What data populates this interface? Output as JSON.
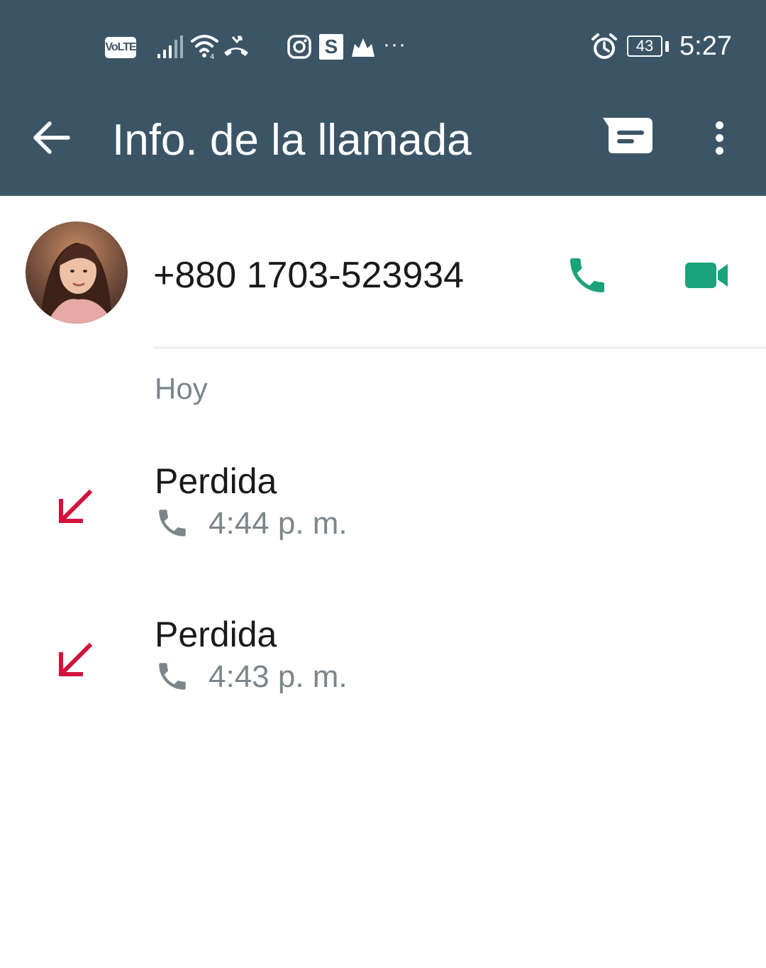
{
  "status_bar": {
    "volte_label": "VoLTE",
    "s_badge": "S",
    "more_notifications": "···",
    "battery_level": "43",
    "time": "5:27"
  },
  "header": {
    "title": "Info. de la llamada",
    "background_color": "#3b5566"
  },
  "contact": {
    "phone_number": "+880 1703-523934",
    "accent_color": "#1aa37a"
  },
  "section": {
    "label": "Hoy"
  },
  "calls": [
    {
      "status": "Perdida",
      "time": "4:44 p. m.",
      "direction_icon": "missed-call-arrow-icon",
      "type_icon": "phone-icon"
    },
    {
      "status": "Perdida",
      "time": "4:43 p. m.",
      "direction_icon": "missed-call-arrow-icon",
      "type_icon": "phone-icon"
    }
  ],
  "colors": {
    "missed": "#d0143c",
    "secondary_text": "#7b868c"
  }
}
